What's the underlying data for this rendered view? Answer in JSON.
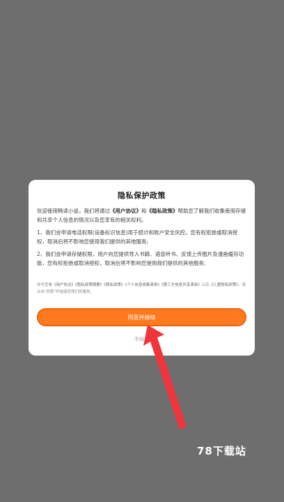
{
  "dialog": {
    "title": "隐私保护政策",
    "intro": {
      "prefix": "欢迎使用畅读小说，我们将通过",
      "link1": "《用户协议》",
      "and": "和",
      "link2": "《隐私政策》",
      "suffix": "帮助您了解我们收集使用存储和共享个人信息的情况以及您享有的相关权利。"
    },
    "item1": "1、我们会申请电话权限(设备标识信息)用于统计和账户安全风控。您有权拒绝或取消授权，取消后将不影响您使用我们提供的其他服务;",
    "item2": "2、我们会申请存储权限，用户向您提供导入书籍、语音听书、反馈上传图片及漫画缓存功能，您有权拒绝或取消授权，取消后将不影响您使用我们提供的其他服务;",
    "notice": {
      "prefix": "你可查看",
      "doc1": "《用户协议》",
      "doc2": "《隐私政策摘要》",
      "doc3": "《隐私政策》",
      "doc4": "《个人信息收集清单》",
      "doc5": "《第三方信息共享清单》",
      "mid": "以及",
      "doc6": "《儿童隐私政策》",
      "suffix": "，请点击\"同意\"开始接受我们的服务。"
    },
    "agree_label": "同意并继续",
    "disagree_label": "不同意"
  },
  "watermark": "78下载站",
  "colors": {
    "overlay": "#6e6e6e",
    "accent": "#ff7a1f",
    "arrow": "#f0343c"
  },
  "icons": {
    "annotation": "red-arrow-icon"
  }
}
